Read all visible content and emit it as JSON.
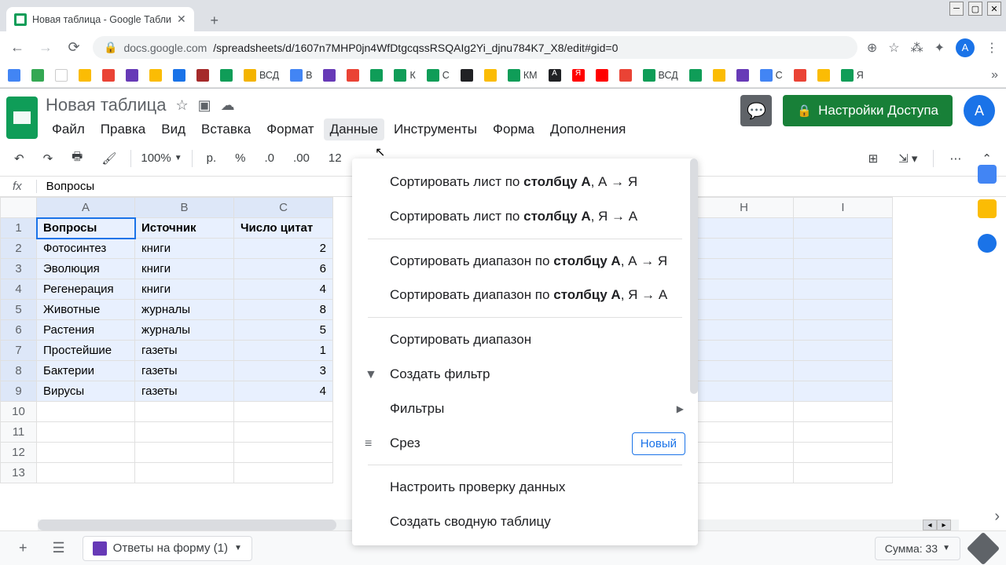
{
  "browser": {
    "tab_title": "Новая таблица - Google Табли",
    "url_prefix": "docs.google.com",
    "url_rest": "/spreadsheets/d/1607n7MHP0jn4WfDtgcqssRSQAIg2Yi_djnu784K7_X8/edit#gid=0",
    "avatar_letter": "A",
    "bookmarks": [
      "ВСД",
      "В",
      "К",
      "С",
      "КМ",
      "ВСД",
      "С",
      "Я"
    ]
  },
  "sheets": {
    "title": "Новая таблица",
    "menus": [
      "Файл",
      "Правка",
      "Вид",
      "Вставка",
      "Формат",
      "Данные",
      "Инструменты",
      "Форма",
      "Дополнения"
    ],
    "active_menu": "Данные",
    "share_label": "Настройки Доступа",
    "avatar_letter": "А",
    "zoom": "100%",
    "currency": "р.",
    "percent": "%",
    "dec_less": ".0",
    "dec_more": ".00",
    "num_123": "12",
    "formula_value": "Вопросы",
    "fx_label": "fx"
  },
  "grid": {
    "columns": [
      "A",
      "B",
      "C",
      "H",
      "I"
    ],
    "hidden_col_area": true,
    "rows": [
      {
        "n": 1,
        "a": "Вопросы",
        "b": "Источник",
        "c": "Число цитат",
        "bold": true
      },
      {
        "n": 2,
        "a": "Фотосинтез",
        "b": "книги",
        "c": "2"
      },
      {
        "n": 3,
        "a": "Эволюция",
        "b": "книги",
        "c": "6"
      },
      {
        "n": 4,
        "a": "Регенерация",
        "b": "книги",
        "c": "4"
      },
      {
        "n": 5,
        "a": "Животные",
        "b": "журналы",
        "c": "8"
      },
      {
        "n": 6,
        "a": "Растения",
        "b": "журналы",
        "c": "5"
      },
      {
        "n": 7,
        "a": "Простейшие",
        "b": "газеты",
        "c": "1"
      },
      {
        "n": 8,
        "a": "Бактерии",
        "b": "газеты",
        "c": "3"
      },
      {
        "n": 9,
        "a": "Вирусы",
        "b": "газеты",
        "c": "4"
      },
      {
        "n": 10,
        "a": "",
        "b": "",
        "c": ""
      },
      {
        "n": 11,
        "a": "",
        "b": "",
        "c": ""
      },
      {
        "n": 12,
        "a": "",
        "b": "",
        "c": ""
      },
      {
        "n": 13,
        "a": "",
        "b": "",
        "c": ""
      }
    ]
  },
  "dropdown": {
    "items": [
      {
        "pre": "Сортировать лист по ",
        "bold": "столбцу A",
        "post": ", А → Я"
      },
      {
        "pre": "Сортировать лист по ",
        "bold": "столбцу A",
        "post": ", Я → А"
      },
      {
        "sep": true
      },
      {
        "pre": "Сортировать диапазон по ",
        "bold": "столбцу A",
        "post": ", А → Я"
      },
      {
        "pre": "Сортировать диапазон по ",
        "bold": "столбцу A",
        "post": ", Я → А"
      },
      {
        "sep": true
      },
      {
        "label": "Сортировать диапазон"
      },
      {
        "label": "Создать фильтр",
        "icon": "filter"
      },
      {
        "label": "Фильтры",
        "arrow": true
      },
      {
        "label": "Срез",
        "icon": "slicer",
        "badge": "Новый"
      },
      {
        "sep": true
      },
      {
        "label": "Настроить проверку данных"
      },
      {
        "label": "Создать сводную таблицу"
      }
    ]
  },
  "bottom": {
    "add_sheet": "+",
    "form_tab": "Ответы на форму (1)",
    "sum_label": "Сумма: 33"
  }
}
